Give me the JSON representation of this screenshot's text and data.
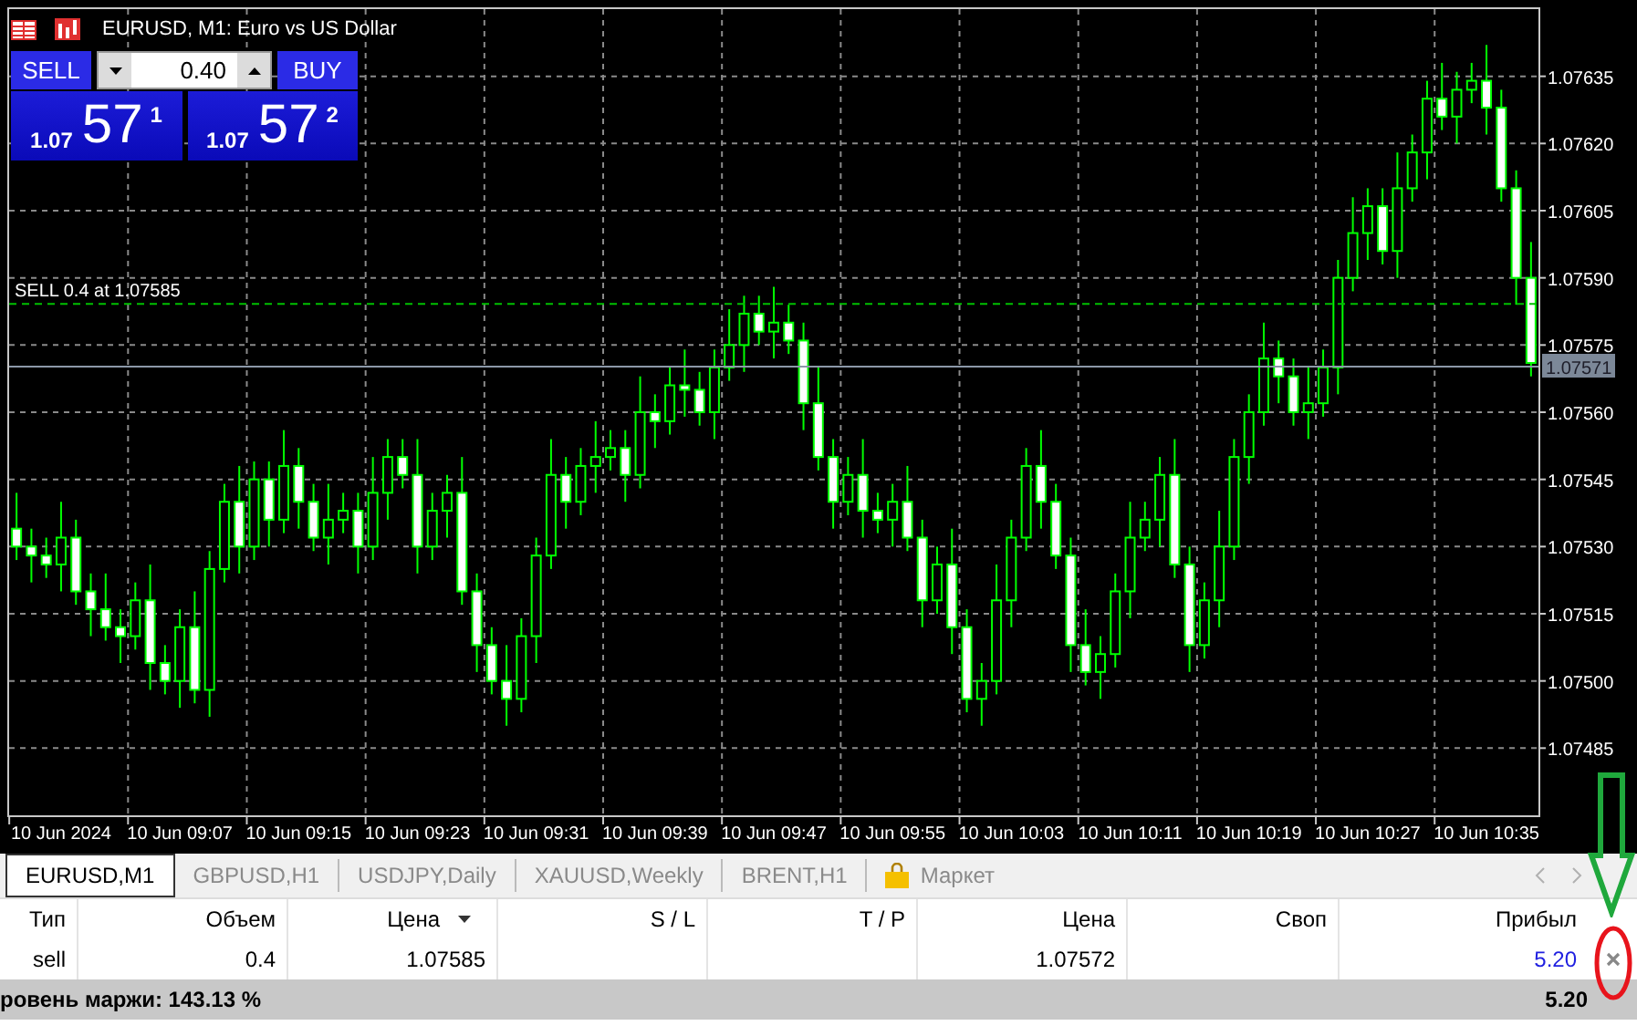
{
  "window": {
    "title": "EURUSD, M1:  Euro vs US Dollar"
  },
  "trade_panel": {
    "sell_label": "SELL",
    "buy_label": "BUY",
    "lot": "0.40",
    "bid": {
      "prefix": "1.07",
      "pips": "57",
      "fraction": "1"
    },
    "ask": {
      "prefix": "1.07",
      "pips": "57",
      "fraction": "2"
    }
  },
  "chart": {
    "order_line": "SELL 0.4 at 1.07585",
    "current_price": "1.07571",
    "chart_data": {
      "type": "candlestick",
      "ylim": [
        1.0747,
        1.0765
      ],
      "grid": true,
      "yticks": [
        {
          "value": 1.07635,
          "label": "1.07635"
        },
        {
          "value": 1.0762,
          "label": "1.07620"
        },
        {
          "value": 1.07605,
          "label": "1.07605"
        },
        {
          "value": 1.0759,
          "label": "1.07590"
        },
        {
          "value": 1.07575,
          "label": "1.07575"
        },
        {
          "value": 1.0756,
          "label": "1.07560"
        },
        {
          "value": 1.07545,
          "label": "1.07545"
        },
        {
          "value": 1.0753,
          "label": "1.07530"
        },
        {
          "value": 1.07515,
          "label": "1.07515"
        },
        {
          "value": 1.075,
          "label": "1.07500"
        },
        {
          "value": 1.07485,
          "label": "1.07485"
        }
      ],
      "categories": [
        null,
        null,
        null,
        "10 Jun 2024",
        null,
        null,
        null,
        null,
        null,
        null,
        null,
        "10 Jun 09:07",
        null,
        null,
        null,
        null,
        null,
        null,
        null,
        "10 Jun 09:15",
        null,
        null,
        null,
        null,
        null,
        null,
        null,
        "10 Jun 09:23",
        null,
        null,
        null,
        null,
        null,
        null,
        null,
        "10 Jun 09:31",
        null,
        null,
        null,
        null,
        null,
        null,
        null,
        "10 Jun 09:39",
        null,
        null,
        null,
        null,
        null,
        null,
        null,
        "10 Jun 09:47",
        null,
        null,
        null,
        null,
        null,
        null,
        null,
        "10 Jun 09:55",
        null,
        null,
        null,
        null,
        null,
        null,
        null,
        "10 Jun 10:03",
        null,
        null,
        null,
        null,
        null,
        null,
        null,
        "10 Jun 10:11",
        null,
        null,
        null,
        null,
        null,
        null,
        null,
        "10 Jun 10:19",
        null,
        null,
        null,
        null,
        null,
        null,
        null,
        "10 Jun 10:27",
        null,
        null,
        null,
        null,
        null,
        null,
        null,
        "10 Jun 10:35",
        null,
        null,
        null
      ],
      "ohlc": [
        [
          1.07534,
          1.07542,
          1.07527,
          1.0753
        ],
        [
          1.0753,
          1.07534,
          1.07522,
          1.07528
        ],
        [
          1.07528,
          1.07532,
          1.07523,
          1.07526
        ],
        [
          1.07526,
          1.0754,
          1.0752,
          1.07532
        ],
        [
          1.07532,
          1.07536,
          1.07517,
          1.0752
        ],
        [
          1.0752,
          1.07524,
          1.0751,
          1.07516
        ],
        [
          1.07516,
          1.07524,
          1.07509,
          1.07512
        ],
        [
          1.07512,
          1.07516,
          1.07504,
          1.0751
        ],
        [
          1.0751,
          1.07522,
          1.07507,
          1.07518
        ],
        [
          1.07518,
          1.07526,
          1.07498,
          1.07504
        ],
        [
          1.07504,
          1.07508,
          1.07497,
          1.075
        ],
        [
          1.075,
          1.07516,
          1.07494,
          1.07512
        ],
        [
          1.07512,
          1.0752,
          1.07495,
          1.07498
        ],
        [
          1.07498,
          1.07529,
          1.07492,
          1.07525
        ],
        [
          1.07525,
          1.07544,
          1.07522,
          1.0754
        ],
        [
          1.0754,
          1.07548,
          1.07524,
          1.0753
        ],
        [
          1.0753,
          1.07549,
          1.07527,
          1.07545
        ],
        [
          1.07545,
          1.07549,
          1.0753,
          1.07536
        ],
        [
          1.07536,
          1.07556,
          1.07533,
          1.07548
        ],
        [
          1.07548,
          1.07552,
          1.07534,
          1.0754
        ],
        [
          1.0754,
          1.07544,
          1.07529,
          1.07532
        ],
        [
          1.07532,
          1.07544,
          1.07526,
          1.07536
        ],
        [
          1.07536,
          1.07542,
          1.07533,
          1.07538
        ],
        [
          1.07538,
          1.07542,
          1.07524,
          1.0753
        ],
        [
          1.0753,
          1.0755,
          1.07527,
          1.07542
        ],
        [
          1.07542,
          1.07554,
          1.07536,
          1.0755
        ],
        [
          1.0755,
          1.07554,
          1.07543,
          1.07546
        ],
        [
          1.07546,
          1.07554,
          1.07524,
          1.0753
        ],
        [
          1.0753,
          1.07542,
          1.07527,
          1.07538
        ],
        [
          1.07538,
          1.07546,
          1.07532,
          1.07542
        ],
        [
          1.07542,
          1.0755,
          1.07517,
          1.0752
        ],
        [
          1.0752,
          1.07524,
          1.07502,
          1.07508
        ],
        [
          1.07508,
          1.07512,
          1.07497,
          1.075
        ],
        [
          1.075,
          1.07508,
          1.0749,
          1.07496
        ],
        [
          1.07496,
          1.07514,
          1.07493,
          1.0751
        ],
        [
          1.0751,
          1.07532,
          1.07504,
          1.07528
        ],
        [
          1.07528,
          1.07554,
          1.07525,
          1.07546
        ],
        [
          1.07546,
          1.0755,
          1.07534,
          1.0754
        ],
        [
          1.0754,
          1.07552,
          1.07537,
          1.07548
        ],
        [
          1.07548,
          1.07558,
          1.07542,
          1.0755
        ],
        [
          1.0755,
          1.07556,
          1.07547,
          1.07552
        ],
        [
          1.07552,
          1.07556,
          1.0754,
          1.07546
        ],
        [
          1.07546,
          1.07568,
          1.07543,
          1.0756
        ],
        [
          1.0756,
          1.07564,
          1.07552,
          1.07558
        ],
        [
          1.07558,
          1.0757,
          1.07555,
          1.07566
        ],
        [
          1.07566,
          1.07574,
          1.07559,
          1.07565
        ],
        [
          1.07565,
          1.07569,
          1.07557,
          1.0756
        ],
        [
          1.0756,
          1.07574,
          1.07554,
          1.0757
        ],
        [
          1.0757,
          1.07583,
          1.07567,
          1.07575
        ],
        [
          1.07575,
          1.07586,
          1.07569,
          1.07582
        ],
        [
          1.07582,
          1.07586,
          1.07575,
          1.07578
        ],
        [
          1.07578,
          1.07588,
          1.07572,
          1.0758
        ],
        [
          1.0758,
          1.07584,
          1.07573,
          1.07576
        ],
        [
          1.07576,
          1.0758,
          1.07556,
          1.07562
        ],
        [
          1.07562,
          1.0757,
          1.07547,
          1.0755
        ],
        [
          1.0755,
          1.07554,
          1.07534,
          1.0754
        ],
        [
          1.0754,
          1.0755,
          1.07537,
          1.07546
        ],
        [
          1.07546,
          1.07554,
          1.07532,
          1.07538
        ],
        [
          1.07538,
          1.07542,
          1.07533,
          1.07536
        ],
        [
          1.07536,
          1.07544,
          1.0753,
          1.0754
        ],
        [
          1.0754,
          1.07548,
          1.07529,
          1.07532
        ],
        [
          1.07532,
          1.07536,
          1.07512,
          1.07518
        ],
        [
          1.07518,
          1.0753,
          1.07515,
          1.07526
        ],
        [
          1.07526,
          1.07534,
          1.07506,
          1.07512
        ],
        [
          1.07512,
          1.07516,
          1.07493,
          1.07496
        ],
        [
          1.07496,
          1.07504,
          1.0749,
          1.075
        ],
        [
          1.075,
          1.07526,
          1.07497,
          1.07518
        ],
        [
          1.07518,
          1.07536,
          1.07512,
          1.07532
        ],
        [
          1.07532,
          1.07552,
          1.07529,
          1.07548
        ],
        [
          1.07548,
          1.07556,
          1.07534,
          1.0754
        ],
        [
          1.0754,
          1.07544,
          1.07525,
          1.07528
        ],
        [
          1.07528,
          1.07532,
          1.07502,
          1.07508
        ],
        [
          1.07508,
          1.07516,
          1.07499,
          1.07502
        ],
        [
          1.07502,
          1.0751,
          1.07496,
          1.07506
        ],
        [
          1.07506,
          1.07524,
          1.07503,
          1.0752
        ],
        [
          1.0752,
          1.0754,
          1.07514,
          1.07532
        ],
        [
          1.07532,
          1.0754,
          1.07529,
          1.07536
        ],
        [
          1.07536,
          1.0755,
          1.0753,
          1.07546
        ],
        [
          1.07546,
          1.07554,
          1.07523,
          1.07526
        ],
        [
          1.07526,
          1.0753,
          1.07502,
          1.07508
        ],
        [
          1.07508,
          1.07522,
          1.07505,
          1.07518
        ],
        [
          1.07518,
          1.07538,
          1.07512,
          1.0753
        ],
        [
          1.0753,
          1.07554,
          1.07527,
          1.0755
        ],
        [
          1.0755,
          1.07564,
          1.07544,
          1.0756
        ],
        [
          1.0756,
          1.0758,
          1.07557,
          1.07572
        ],
        [
          1.07572,
          1.07576,
          1.07562,
          1.07568
        ],
        [
          1.07568,
          1.07572,
          1.07557,
          1.0756
        ],
        [
          1.0756,
          1.0757,
          1.07554,
          1.07562
        ],
        [
          1.07562,
          1.07574,
          1.07559,
          1.0757
        ],
        [
          1.0757,
          1.07594,
          1.07564,
          1.0759
        ],
        [
          1.0759,
          1.07608,
          1.07587,
          1.076
        ],
        [
          1.076,
          1.0761,
          1.07594,
          1.07606
        ],
        [
          1.07606,
          1.0761,
          1.07593,
          1.07596
        ],
        [
          1.07596,
          1.07618,
          1.0759,
          1.0761
        ],
        [
          1.0761,
          1.07622,
          1.07607,
          1.07618
        ],
        [
          1.07618,
          1.07634,
          1.07612,
          1.0763
        ],
        [
          1.0763,
          1.07638,
          1.07623,
          1.07626
        ],
        [
          1.07626,
          1.07636,
          1.0762,
          1.07632
        ],
        [
          1.07632,
          1.07638,
          1.07629,
          1.07634
        ],
        [
          1.07634,
          1.07642,
          1.07622,
          1.07628
        ],
        [
          1.07628,
          1.07632,
          1.07607,
          1.0761
        ],
        [
          1.0761,
          1.07614,
          1.07584,
          1.0759
        ],
        [
          1.0759,
          1.07598,
          1.07568,
          1.07571
        ]
      ]
    }
  },
  "tabs": [
    {
      "label": "EURUSD,M1",
      "selected": true,
      "kind": "chart"
    },
    {
      "label": "GBPUSD,H1",
      "selected": false,
      "kind": "chart"
    },
    {
      "label": "USDJPY,Daily",
      "selected": false,
      "kind": "chart"
    },
    {
      "label": "XAUUSD,Weekly",
      "selected": false,
      "kind": "chart"
    },
    {
      "label": "BRENT,H1",
      "selected": false,
      "kind": "chart"
    },
    {
      "label": "Маркет",
      "selected": false,
      "kind": "market"
    }
  ],
  "table": {
    "columns": [
      {
        "label": "Тип",
        "sorted": false
      },
      {
        "label": "Объем",
        "sorted": false
      },
      {
        "label": "Цена",
        "sorted": true
      },
      {
        "label": "S / L",
        "sorted": false
      },
      {
        "label": "T / P",
        "sorted": false
      },
      {
        "label": "Цена",
        "sorted": false
      },
      {
        "label": "Своп",
        "sorted": false
      },
      {
        "label": "Прибыл",
        "sorted": false
      }
    ],
    "rows": [
      {
        "cells": [
          "sell",
          "0.4",
          "1.07585",
          null,
          null,
          "1.07572",
          null,
          "5.20"
        ],
        "closable": true
      }
    ]
  },
  "footer": {
    "margin_level": "ровень маржи: 143.13 %",
    "total": "5.20"
  },
  "annotations": [
    {
      "kind": "arrow",
      "color": "#1fa83c"
    },
    {
      "kind": "ellipse",
      "color": "#e8141c"
    }
  ]
}
